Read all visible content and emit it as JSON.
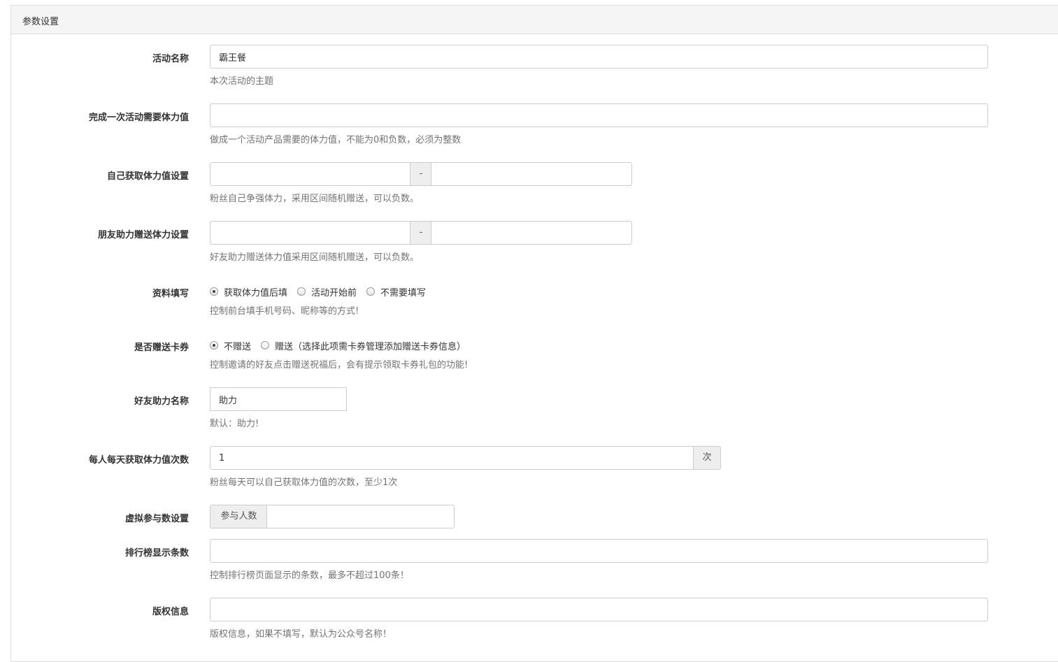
{
  "panel": {
    "title": "参数设置"
  },
  "fields": {
    "activity_name": {
      "label": "活动名称",
      "value": "霸王餐",
      "help": "本次活动的主题"
    },
    "stamina_required": {
      "label": "完成一次活动需要体力值",
      "value": "",
      "help": "做成一个活动产品需要的体力值，不能为0和负数，必须为整数"
    },
    "self_stamina": {
      "label": "自己获取体力值设置",
      "min": "",
      "sep": "-",
      "max": "",
      "help": "粉丝自己争强体力，采用区间随机赠送，可以负数。"
    },
    "friend_stamina": {
      "label": "朋友助力赠送体力设置",
      "min": "",
      "sep": "-",
      "max": "",
      "help": "好友助力赠送体力值采用区间随机赠送，可以负数。"
    },
    "info_fill": {
      "label": "资料填写",
      "options": [
        "获取体力值后填",
        "活动开始前",
        "不需要填写"
      ],
      "selected": 0,
      "help": "控制前台填手机号码、昵称等的方式!"
    },
    "gift_card": {
      "label": "是否赠送卡券",
      "options": [
        "不赠送",
        "赠送（选择此项需卡券管理添加赠送卡券信息）"
      ],
      "selected": 0,
      "help": "控制邀请的好友点击赠送祝福后，会有提示领取卡券礼包的功能!"
    },
    "help_name": {
      "label": "好友助力名称",
      "value": "助力",
      "help": "默认：助力!"
    },
    "daily_times": {
      "label": "每人每天获取体力值次数",
      "value": "1",
      "unit": "次",
      "help": "粉丝每天可以自己获取体力值的次数，至少1次"
    },
    "virtual_participants": {
      "label": "虚拟参与数设置",
      "addon": "参与人数",
      "value": ""
    },
    "rank_count": {
      "label": "排行榜显示条数",
      "value": "",
      "help": "控制排行榜页面显示的条数，最多不超过100条！"
    },
    "copyright": {
      "label": "版权信息",
      "value": "",
      "help": "版权信息，如果不填写，默认为公众号名称！"
    }
  }
}
